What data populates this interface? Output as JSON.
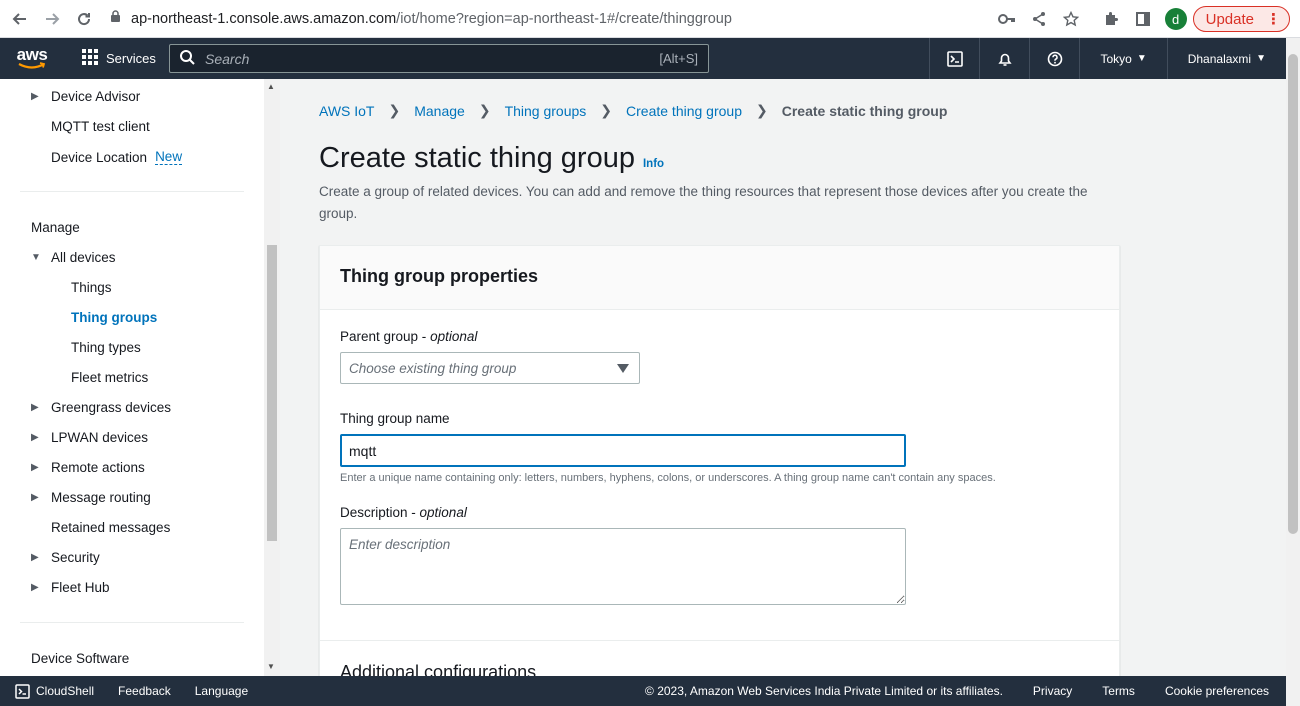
{
  "browser": {
    "url_host": "ap-northeast-1.console.aws.amazon.com",
    "url_path": "/iot/home?region=ap-northeast-1#/create/thinggroup",
    "avatar_letter": "d",
    "update_label": "Update"
  },
  "topnav": {
    "logo": "aws",
    "services_label": "Services",
    "search_placeholder": "Search",
    "search_shortcut": "[Alt+S]",
    "region": "Tokyo",
    "user": "Dhanalaxmi"
  },
  "sidebar": {
    "items": [
      {
        "label": "Device Advisor"
      },
      {
        "label": "MQTT test client"
      },
      {
        "label": "Device Location",
        "badge": "New"
      },
      {
        "label": "All devices"
      },
      {
        "label": "Things"
      },
      {
        "label": "Thing groups"
      },
      {
        "label": "Thing types"
      },
      {
        "label": "Fleet metrics"
      },
      {
        "label": "Greengrass devices"
      },
      {
        "label": "LPWAN devices"
      },
      {
        "label": "Remote actions"
      },
      {
        "label": "Message routing"
      },
      {
        "label": "Retained messages"
      },
      {
        "label": "Security"
      },
      {
        "label": "Fleet Hub"
      }
    ],
    "section_manage": "Manage",
    "section_device_software": "Device Software"
  },
  "breadcrumbs": [
    "AWS IoT",
    "Manage",
    "Thing groups",
    "Create thing group",
    "Create static thing group"
  ],
  "page": {
    "title": "Create static thing group",
    "info": "Info",
    "description": "Create a group of related devices. You can add and remove the thing resources that represent those devices after you create the group."
  },
  "form": {
    "panel_title": "Thing group properties",
    "parent_label": "Parent group - ",
    "optional": "optional",
    "parent_placeholder": "Choose existing thing group",
    "name_label": "Thing group name",
    "name_value": "mqtt",
    "name_hint": "Enter a unique name containing only: letters, numbers, hyphens, colons, or underscores. A thing group name can't contain any spaces.",
    "desc_label": "Description - ",
    "desc_placeholder": "Enter description",
    "additional": "Additional configurations"
  },
  "footer": {
    "cloudshell": "CloudShell",
    "feedback": "Feedback",
    "language": "Language",
    "copyright": "© 2023, Amazon Web Services India Private Limited or its affiliates.",
    "privacy": "Privacy",
    "terms": "Terms",
    "cookies": "Cookie preferences"
  },
  "colors": {
    "aws_nav": "#232f3e",
    "link": "#0073bb",
    "update_red": "#d93025"
  }
}
